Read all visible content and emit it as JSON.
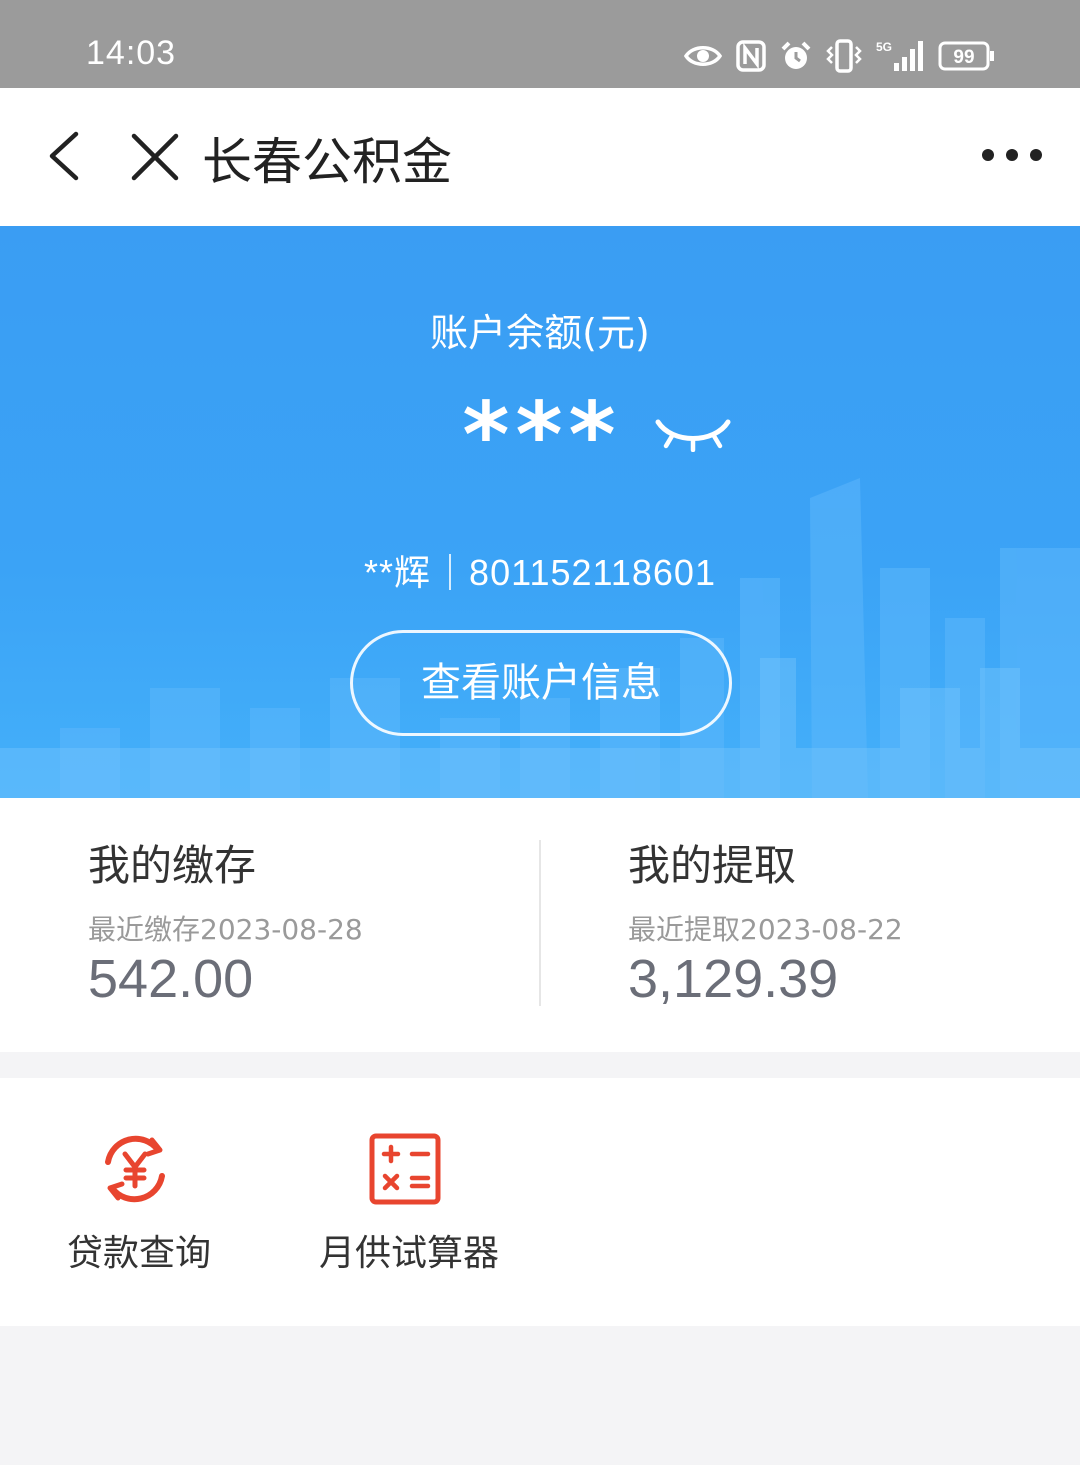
{
  "status_bar": {
    "time": "14:03",
    "network": "5G",
    "battery": "99",
    "icons": [
      "eye-icon",
      "nfc-icon",
      "alarm-icon",
      "vibrate-icon",
      "signal-icon",
      "battery-icon"
    ]
  },
  "nav": {
    "title": "长春公积金",
    "back_icon": "chevron-left-icon",
    "close_icon": "close-icon",
    "more_icon": "more-icon"
  },
  "hero": {
    "label": "账户余额(元)",
    "balance_masked": "***",
    "account_name": "**辉",
    "account_number": "801152118601",
    "button_label": "查看账户信息"
  },
  "summary": {
    "deposit": {
      "title": "我的缴存",
      "subtitle": "最近缴存2023-08-28",
      "value": "542.00"
    },
    "withdraw": {
      "title": "我的提取",
      "subtitle": "最近提取2023-08-22",
      "value": "3,129.39"
    }
  },
  "services": {
    "items": [
      {
        "label": "贷款查询",
        "icon": "yuan-exchange-icon"
      },
      {
        "label": "月供试算器",
        "icon": "calculator-icon"
      }
    ]
  },
  "colors": {
    "hero_blue": "#3ba3f6",
    "icon_red": "#e8452f",
    "value_gray": "#6b6e78"
  }
}
